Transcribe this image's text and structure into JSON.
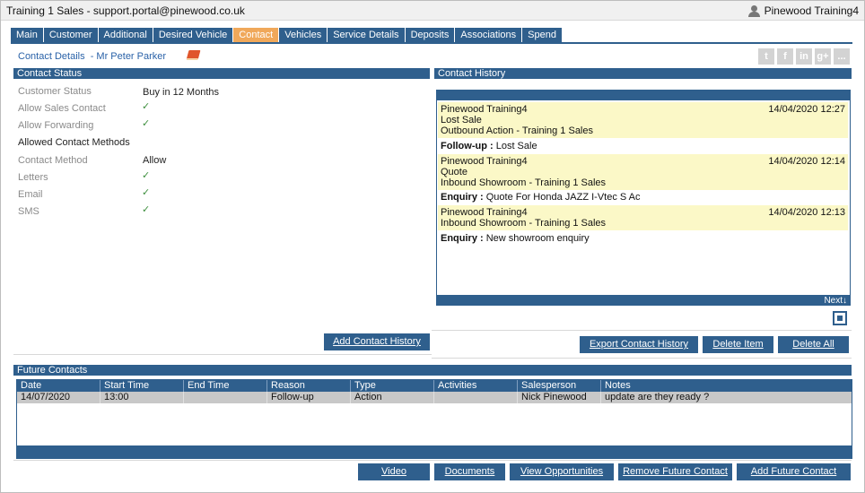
{
  "window": {
    "title": "Training 1 Sales - support.portal@pinewood.co.uk",
    "user": "Pinewood Training4"
  },
  "tabs": [
    {
      "label": "Main"
    },
    {
      "label": "Customer"
    },
    {
      "label": "Additional"
    },
    {
      "label": "Desired Vehicle"
    },
    {
      "label": "Contact",
      "active": true
    },
    {
      "label": "Vehicles"
    },
    {
      "label": "Service Details"
    },
    {
      "label": "Deposits"
    },
    {
      "label": "Associations"
    },
    {
      "label": "Spend"
    }
  ],
  "subheader": "Contact Details  - Mr Peter Parker",
  "social": [
    "twitter-icon",
    "facebook-icon",
    "linkedin-icon",
    "googleplus-icon",
    "share-icon"
  ],
  "social_glyphs": [
    "t",
    "f",
    "in",
    "g+",
    "..."
  ],
  "contact_status": {
    "header": "Contact Status",
    "customer_status_label": "Customer Status",
    "customer_status_value": "Buy in 12 Months",
    "allow_sales_label": "Allow Sales Contact",
    "allow_forwarding_label": "Allow Forwarding",
    "allowed_methods_label": "Allowed Contact Methods",
    "contact_method_label": "Contact Method",
    "contact_method_value": "Allow",
    "letters_label": "Letters",
    "email_label": "Email",
    "sms_label": "SMS",
    "check": "✓",
    "add_history_button": "Add Contact History"
  },
  "contact_history": {
    "header": "Contact History",
    "entries": [
      {
        "user": "Pinewood Training4",
        "date": "14/04/2020 12:27",
        "line2": "Lost Sale",
        "line3": "Outbound Action - Training 1 Sales",
        "note_label": "Follow-up :",
        "note": " Lost Sale"
      },
      {
        "user": "Pinewood Training4",
        "date": "14/04/2020 12:14",
        "line2": "Quote",
        "line3": "Inbound Showroom - Training 1 Sales",
        "note_label": "Enquiry :",
        "note": " Quote For Honda JAZZ I-Vtec S Ac"
      },
      {
        "user": "Pinewood Training4",
        "date": "14/04/2020 12:13",
        "line2": "Inbound Showroom - Training 1 Sales",
        "note_label": "Enquiry :",
        "note": " New showroom enquiry"
      }
    ],
    "next_label": "Next↓",
    "export_button": "Export Contact History",
    "delete_item_button": "Delete Item",
    "delete_all_button": "Delete All"
  },
  "future_contacts": {
    "header": "Future Contacts",
    "columns": [
      "Date",
      "Start Time",
      "End Time",
      "Reason",
      "Type",
      "Activities",
      "Salesperson",
      "Notes"
    ],
    "rows": [
      [
        "14/07/2020",
        "13:00",
        "",
        "Follow-up",
        "Action",
        "",
        "Nick Pinewood",
        "update are they ready ?"
      ]
    ]
  },
  "footer_buttons": {
    "video": "Video",
    "documents": "Documents",
    "view_opportunities": "View Opportunities",
    "remove_future_contact": "Remove Future Contact",
    "add_future_contact": "Add Future Contact"
  }
}
